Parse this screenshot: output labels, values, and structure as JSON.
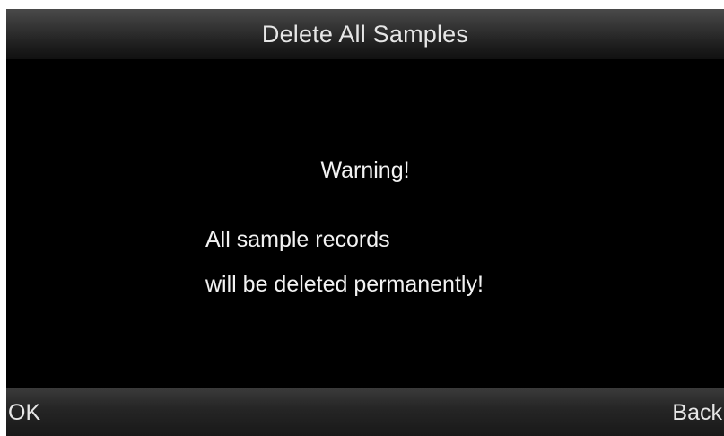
{
  "header": {
    "title": "Delete All Samples"
  },
  "dialog": {
    "heading": "Warning!",
    "message_line_1": "All sample records",
    "message_line_2": "will be deleted permanently!"
  },
  "softkeys": {
    "left_label": "OK",
    "right_label": "Back"
  },
  "colors": {
    "background": "#000000",
    "text": "#f2f2f2",
    "bar_gradient_top": "#4a4a4a",
    "bar_gradient_bottom": "#111111"
  }
}
